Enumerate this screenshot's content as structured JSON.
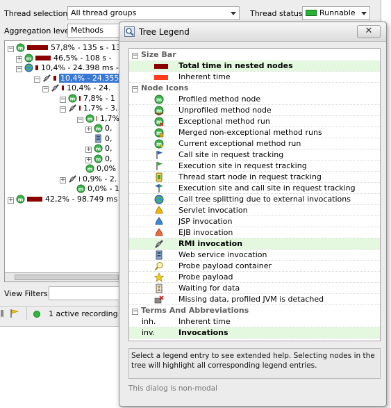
{
  "main_window": {
    "thread_selection_label": "Thread selection:",
    "thread_selection_value": "All thread groups",
    "thread_status_label": "Thread status:",
    "thread_status_value": "Runnable",
    "aggregation_label": "Aggregation level:",
    "aggregation_value": "Methods",
    "view_filters_label": "View Filters:",
    "recording_status": "1 active recording",
    "tree_rows": [
      {
        "expander": "−",
        "icon": "profiled-method-icon",
        "text": "57,8% - 135 s - 13"
      },
      {
        "expander": "+",
        "icon": "profiled-method-icon",
        "text": "46,5% - 108 s -"
      },
      {
        "expander": "−",
        "icon": "call-tree-split-icon",
        "text": "10,4% - 24.398 ms -"
      },
      {
        "expander": "−",
        "icon": "rmi-invocation-icon",
        "text": "10,4% - 24.355",
        "selected": true
      },
      {
        "expander": "−",
        "icon": "rmi-invocation-icon",
        "text": "10,4% - 24."
      },
      {
        "expander": "−",
        "icon": "profiled-method-icon",
        "text": "7,8% - 1"
      },
      {
        "expander": "−",
        "icon": "rmi-invocation-icon",
        "text": "1,7% - 3."
      },
      {
        "expander": "−",
        "icon": "profiled-method-icon",
        "text": "1,7%"
      },
      {
        "expander": "+",
        "icon": "profiled-method-icon",
        "text": "0,"
      },
      {
        "expander": "",
        "icon": "web-service-icon",
        "text": "0,"
      },
      {
        "expander": "+",
        "icon": "profiled-method-icon",
        "text": "0,"
      },
      {
        "expander": "+",
        "icon": "profiled-method-icon",
        "text": "0,"
      },
      {
        "expander": "",
        "icon": "profiled-method-icon",
        "text": "0,0%"
      },
      {
        "expander": "+",
        "icon": "rmi-invocation-icon",
        "text": "0,9% - 2."
      },
      {
        "expander": "",
        "icon": "profiled-method-icon",
        "text": "0,0% - 1."
      },
      {
        "expander": "+",
        "icon": "profiled-method-icon",
        "text": "42,2% - 98.749 ms -"
      }
    ]
  },
  "dialog": {
    "title": "Tree Legend",
    "close_label": "✕",
    "sections": [
      {
        "title": "Size Bar",
        "items": [
          {
            "icon": "size-bar-total",
            "label": "Total time in nested nodes",
            "highlight": true,
            "bold": true
          },
          {
            "icon": "size-bar-inherent",
            "label": "Inherent time"
          }
        ]
      },
      {
        "title": "Node Icons",
        "items": [
          {
            "icon": "profiled-method-icon",
            "label": "Profiled method node"
          },
          {
            "icon": "unprofiled-method-icon",
            "label": "Unprofiled method node"
          },
          {
            "icon": "exceptional-method-icon",
            "label": "Exceptional method run"
          },
          {
            "icon": "merged-method-runs-icon",
            "label": "Merged non-exceptional method runs"
          },
          {
            "icon": "current-exceptional-icon",
            "label": "Current exceptional method run"
          },
          {
            "icon": "call-site-icon",
            "label": "Call site in request tracking"
          },
          {
            "icon": "execution-site-icon",
            "label": "Execution site in request tracking"
          },
          {
            "icon": "thread-start-icon",
            "label": "Thread start node in request tracking"
          },
          {
            "icon": "execution-call-site-icon",
            "label": "Execution site and call site in request tracking"
          },
          {
            "icon": "call-tree-split-icon",
            "label": "Call tree splitting due to external invocations"
          },
          {
            "icon": "servlet-invocation-icon",
            "label": "Servlet invocation"
          },
          {
            "icon": "jsp-invocation-icon",
            "label": "JSP invocation"
          },
          {
            "icon": "ejb-invocation-icon",
            "label": "EJB invocation"
          },
          {
            "icon": "rmi-invocation-icon",
            "label": "RMI invocation",
            "highlight": true,
            "bold": true
          },
          {
            "icon": "web-service-icon",
            "label": "Web service invocation"
          },
          {
            "icon": "probe-payload-container-icon",
            "label": "Probe payload container"
          },
          {
            "icon": "probe-payload-icon",
            "label": "Probe payload"
          },
          {
            "icon": "waiting-for-data-icon",
            "label": "Waiting for data"
          },
          {
            "icon": "missing-data-icon",
            "label": "Missing data, profiled JVM is detached"
          }
        ]
      },
      {
        "title": "Terms And Abbreviations",
        "items": [
          {
            "term": "inh.",
            "label": "Inherent time"
          },
          {
            "term": "inv.",
            "label": "Invocations",
            "highlight": true,
            "bold": true
          }
        ]
      }
    ],
    "help_text": "Select a legend entry to see extended help. Selecting nodes in the tree will highlight all corresponding legend entries.",
    "footer_text": "This dialog is non-modal"
  },
  "colors": {
    "size_bar_total": "#8b0000",
    "size_bar_inherent": "#ff3b1f",
    "highlight": "#e3f8df",
    "selection": "#3a78d6",
    "runnable": "#27b335"
  }
}
